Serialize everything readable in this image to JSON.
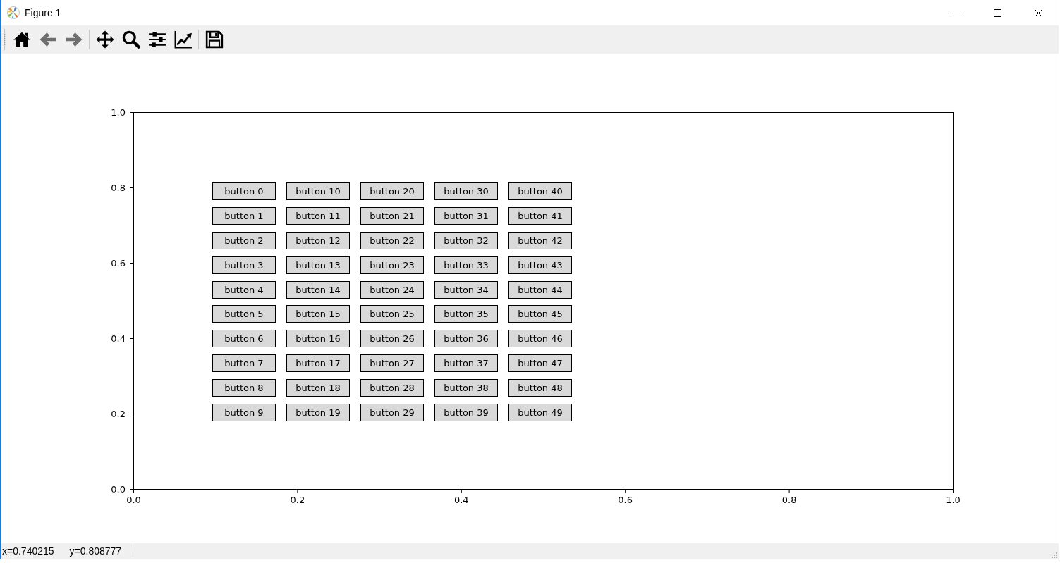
{
  "window": {
    "title": "Figure 1"
  },
  "toolbar": {
    "groups": [
      [
        {
          "disabled": false
        },
        {
          "disabled": true
        },
        {
          "disabled": true
        }
      ],
      [
        {
          "disabled": false
        },
        {
          "disabled": false
        },
        {
          "disabled": false
        },
        {
          "disabled": false
        }
      ],
      [
        {
          "disabled": false
        }
      ]
    ]
  },
  "figure": {
    "chart_data": {
      "type": "line",
      "xlim": [
        0,
        1
      ],
      "ylim": [
        0,
        1
      ],
      "xticks": [
        {
          "value": 0,
          "label": "0.0"
        },
        {
          "value": 0.2,
          "label": "0.2"
        },
        {
          "value": 0.4,
          "label": "0.4"
        },
        {
          "value": 0.6,
          "label": "0.6"
        },
        {
          "value": 0.8,
          "label": "0.8"
        },
        {
          "value": 1,
          "label": "1.0"
        }
      ],
      "yticks": [
        {
          "value": 0,
          "label": "0.0"
        },
        {
          "value": 0.2,
          "label": "0.2"
        },
        {
          "value": 0.4,
          "label": "0.4"
        },
        {
          "value": 0.6,
          "label": "0.6"
        },
        {
          "value": 0.8,
          "label": "0.8"
        },
        {
          "value": 1,
          "label": "1.0"
        }
      ]
    },
    "button_columns": [
      [
        "button 0",
        "button 1",
        "button 2",
        "button 3",
        "button 4",
        "button 5",
        "button 6",
        "button 7",
        "button 8",
        "button 9"
      ],
      [
        "button 10",
        "button 11",
        "button 12",
        "button 13",
        "button 14",
        "button 15",
        "button 16",
        "button 17",
        "button 18",
        "button 19"
      ],
      [
        "button 20",
        "button 21",
        "button 22",
        "button 23",
        "button 24",
        "button 25",
        "button 26",
        "button 27",
        "button 28",
        "button 29"
      ],
      [
        "button 30",
        "button 31",
        "button 32",
        "button 33",
        "button 34",
        "button 35",
        "button 36",
        "button 37",
        "button 38",
        "button 39"
      ],
      [
        "button 40",
        "button 41",
        "button 42",
        "button 43",
        "button 44",
        "button 45",
        "button 46",
        "button 47",
        "button 48",
        "button 49"
      ]
    ]
  },
  "status_bar": {
    "coordinates": [
      "x=0.740215",
      "y=0.808777"
    ]
  }
}
